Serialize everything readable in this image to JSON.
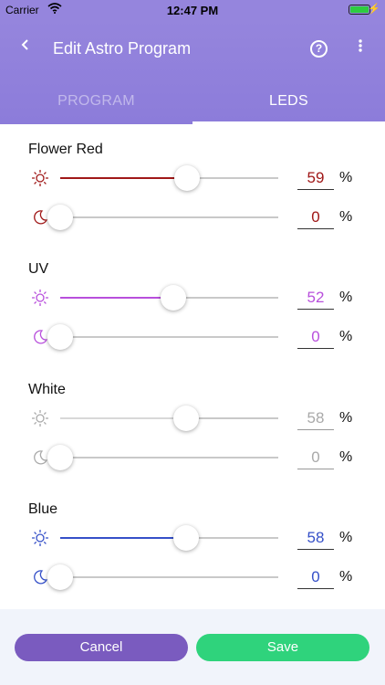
{
  "status_bar": {
    "carrier": "Carrier",
    "time": "12:47 PM"
  },
  "header": {
    "title": "Edit Astro Program",
    "back_icon": "chevron-left-icon",
    "help_label": "?",
    "more_icon": "more-vertical-icon"
  },
  "tabs": [
    {
      "label": "PROGRAM",
      "active": false
    },
    {
      "label": "LEDS",
      "active": true
    }
  ],
  "channels": [
    {
      "name": "Flower Red",
      "color": "#a01818",
      "day": {
        "value": "59",
        "level": 0.59
      },
      "night": {
        "value": "0",
        "level": 0
      }
    },
    {
      "name": "UV",
      "color": "#b84fdc",
      "day": {
        "value": "52",
        "level": 0.52
      },
      "night": {
        "value": "0",
        "level": 0
      }
    },
    {
      "name": "White",
      "color": "#a9a9a9",
      "day": {
        "value": "58",
        "level": 0.58
      },
      "night": {
        "value": "0",
        "level": 0
      }
    },
    {
      "name": "Blue",
      "color": "#3550c8",
      "day": {
        "value": "58",
        "level": 0.58
      },
      "night": {
        "value": "0",
        "level": 0
      }
    }
  ],
  "percent_symbol": "%",
  "footer": {
    "cancel_label": "Cancel",
    "save_label": "Save"
  },
  "colors": {
    "accent": "#9585dd",
    "cancel": "#7a5bbf",
    "save": "#2fd37c"
  }
}
